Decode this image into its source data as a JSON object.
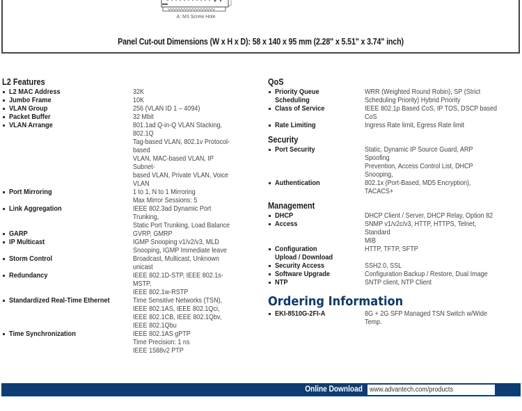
{
  "diagram": {
    "caption": "A: M3 Screw Hole",
    "panel_dimensions": "Panel Cut-out Dimensions (W x H x D): 58 x 140 x 95 mm (2.28\" x 5.51\" x 3.74\" inch)"
  },
  "l2_features": {
    "title": "L2 Features",
    "items": [
      {
        "label": "L2 MAC Address",
        "value": "32K"
      },
      {
        "label": "Jumbo Frame",
        "value": "10K"
      },
      {
        "label": "VLAN Group",
        "value": "256 (VLAN ID 1 – 4094)"
      },
      {
        "label": "Packet Buffer",
        "value": "32 Mbit"
      },
      {
        "label": "VLAN Arrange",
        "value": "801.1ad Q-in-Q VLAN Stacking, 802.1Q\nTag-based VLAN, 802.1v Protocol-based\nVLAN, MAC-based VLAN, IP Subnet-\nbased VLAN, Private VLAN, Voice VLAN"
      },
      {
        "label": "Port Mirroring",
        "value": "1 to 1, N to 1 Mirroring\nMax Mirror Sessions: 5"
      },
      {
        "label": "Link Aggregation",
        "value": "IEEE 802.3ad Dynamic Port Trunking,\nStatic Port Trunking, Load Balance"
      },
      {
        "label": "GARP",
        "value": "GVRP, GMRP"
      },
      {
        "label": "IP Multicast",
        "value": "IGMP Snooping v1/v2/v3, MLD\nSnooping, IGMP Immediate leave"
      },
      {
        "label": "Storm Control",
        "value": "Broadcast, Multicast, Unknown unicast"
      },
      {
        "label": "Redundancy",
        "value": "IEEE 802.1D-STP, IEEE 802.1s-MSTP,\nIEEE 802.1w-RSTP"
      },
      {
        "label": "Standardized Real-Time Ethernet",
        "value": "Time Sensitive Networks (TSN),\nIEEE 802.1AS, IEEE 802.1Qci,\nIEEE 802.1CB, IEEE 802.1Qbv,\nIEEE 802.1Qbu"
      },
      {
        "label": "Time Synchronization",
        "value": "IEEE 802.1AS gPTP\nTime Precision: 1 ns\nIEEE 1588v2 PTP"
      }
    ]
  },
  "qos": {
    "title": "QoS",
    "items": [
      {
        "label": "Priority Queue Scheduling",
        "value": "WRR (Weighted Round Robin), SP (Strict\nScheduling Priority) Hybrid Priority"
      },
      {
        "label": "Class of Service",
        "value": "IEEE 802.1p Based CoS, IP TOS, DSCP based CoS"
      },
      {
        "label": "Rate Limiting",
        "value": "Ingress Rate limit, Egress Rate limit"
      }
    ]
  },
  "security": {
    "title": "Security",
    "items": [
      {
        "label": "Port Security",
        "value": "Static, Dynamic IP Source Guard, ARP Spoofing\nPrevention, Access Control List, DHCP Snooping,"
      },
      {
        "label": "Authentication",
        "value": "802.1x (Port-Based, MD5 Encryption), TACACS+"
      }
    ]
  },
  "management": {
    "title": "Management",
    "items": [
      {
        "label": "DHCP",
        "value": "DHCP Client / Server, DHCP Relay, Option 82"
      },
      {
        "label": "Access",
        "value": "SNMP v1/v2c/v3, HTTP, HTTPS, Telnet, Standard\nMIB"
      },
      {
        "label": "Configuration\nUpload / Download",
        "value": "HTTP, TFTP, SFTP"
      },
      {
        "label": "Security Access",
        "value": "SSH2.0, SSL"
      },
      {
        "label": "Software Upgrade",
        "value": "Configuration Backup / Restore, Dual Image"
      },
      {
        "label": "NTP",
        "value": "SNTP client, NTP Client"
      }
    ]
  },
  "ordering": {
    "title": "Ordering Information",
    "items": [
      {
        "label": "EKI-8510G-2FI-A",
        "value": "8G + 2G SFP Managed TSN Switch w/Wide Temp."
      }
    ]
  },
  "footer": {
    "label": "Online Download",
    "url": "www.advantech.com/products"
  }
}
